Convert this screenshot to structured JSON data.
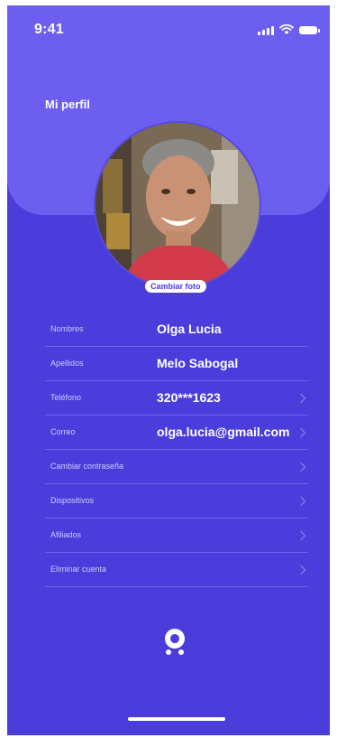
{
  "status_bar": {
    "time": "9:41",
    "signal_icon": "signal-icon",
    "wifi_icon": "wifi-icon",
    "battery_icon": "battery-icon"
  },
  "header": {
    "title": "Mi perfil"
  },
  "profile": {
    "avatar_icon": "avatar",
    "change_photo_label": "Cambiar foto"
  },
  "fields": [
    {
      "label": "Nombres",
      "value": "Olga Lucia",
      "chevron": false
    },
    {
      "label": "Apellidos",
      "value": "Melo Sabogal",
      "chevron": false
    },
    {
      "label": "Teléfono",
      "value": "320***1623",
      "chevron": true
    },
    {
      "label": "Correo",
      "value": "olga.lucia@gmail.com",
      "chevron": true
    },
    {
      "label": "Cambiar contraseña",
      "value": "",
      "chevron": true
    },
    {
      "label": "Dispositivos",
      "value": "",
      "chevron": true
    },
    {
      "label": "Afiliados",
      "value": "",
      "chevron": true
    },
    {
      "label": "Eliminar cuenta",
      "value": "",
      "chevron": true
    }
  ],
  "footer": {
    "logo_icon": "app-logo-icon"
  },
  "colors": {
    "background": "#4a3ddb",
    "header": "#6c5ff0",
    "text": "#ffffff"
  }
}
